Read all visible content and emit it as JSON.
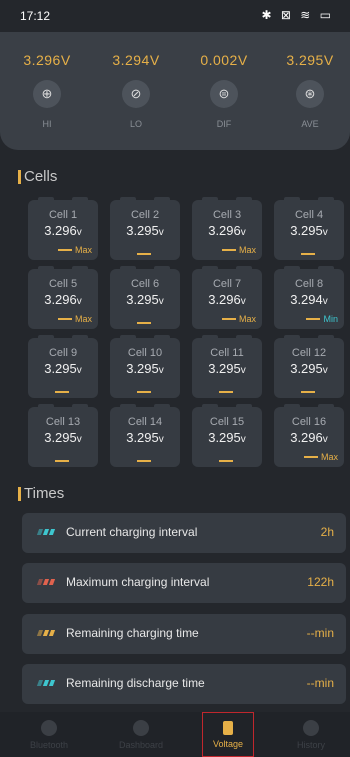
{
  "status_bar": {
    "time": "17:12",
    "icons": "✱ ⊠ ≋ ▭"
  },
  "metrics": [
    {
      "value": "3.296V",
      "label": "HI",
      "icon": "hi-gauge-icon",
      "glyph": "⊕"
    },
    {
      "value": "3.294V",
      "label": "LO",
      "icon": "lo-gauge-icon",
      "glyph": "⊘"
    },
    {
      "value": "0.002V",
      "label": "DIF",
      "icon": "dif-gauge-icon",
      "glyph": "⊜"
    },
    {
      "value": "3.295V",
      "label": "AVE",
      "icon": "ave-gauge-icon",
      "glyph": "⊛"
    }
  ],
  "cells_title": "Cells",
  "cells": [
    {
      "name": "Cell 1",
      "voltage": "3.296",
      "unit": "v",
      "tag": "Max"
    },
    {
      "name": "Cell 2",
      "voltage": "3.295",
      "unit": "v",
      "tag": ""
    },
    {
      "name": "Cell 3",
      "voltage": "3.296",
      "unit": "v",
      "tag": "Max"
    },
    {
      "name": "Cell 4",
      "voltage": "3.295",
      "unit": "v",
      "tag": ""
    },
    {
      "name": "Cell 5",
      "voltage": "3.296",
      "unit": "v",
      "tag": "Max"
    },
    {
      "name": "Cell 6",
      "voltage": "3.295",
      "unit": "v",
      "tag": ""
    },
    {
      "name": "Cell 7",
      "voltage": "3.296",
      "unit": "v",
      "tag": "Max"
    },
    {
      "name": "Cell 8",
      "voltage": "3.294",
      "unit": "v",
      "tag": "Min"
    },
    {
      "name": "Cell 9",
      "voltage": "3.295",
      "unit": "v",
      "tag": ""
    },
    {
      "name": "Cell 10",
      "voltage": "3.295",
      "unit": "v",
      "tag": ""
    },
    {
      "name": "Cell 11",
      "voltage": "3.295",
      "unit": "v",
      "tag": ""
    },
    {
      "name": "Cell 12",
      "voltage": "3.295",
      "unit": "v",
      "tag": ""
    },
    {
      "name": "Cell 13",
      "voltage": "3.295",
      "unit": "v",
      "tag": ""
    },
    {
      "name": "Cell 14",
      "voltage": "3.295",
      "unit": "v",
      "tag": ""
    },
    {
      "name": "Cell 15",
      "voltage": "3.295",
      "unit": "v",
      "tag": ""
    },
    {
      "name": "Cell 16",
      "voltage": "3.296",
      "unit": "v",
      "tag": "Max"
    }
  ],
  "times_title": "Times",
  "times": [
    {
      "label": "Current charging interval",
      "value": "2h",
      "color": "#3ec6cf"
    },
    {
      "label": "Maximum charging interval",
      "value": "122h",
      "color": "#e0624e"
    },
    {
      "label": "Remaining charging time",
      "value": "--min",
      "color": "#e6b048"
    },
    {
      "label": "Remaining discharge time",
      "value": "--min",
      "color": "#3ec6cf"
    }
  ],
  "nav": [
    {
      "label": "Bluetooth",
      "icon": "bluetooth-icon"
    },
    {
      "label": "Dashboard",
      "icon": "dashboard-icon"
    },
    {
      "label": "Voltage",
      "icon": "battery-icon",
      "active": true
    },
    {
      "label": "History",
      "icon": "user-icon"
    }
  ],
  "colors": {
    "accent": "#e6b048",
    "min": "#3ec6cf",
    "active_border": "#c0272d"
  }
}
